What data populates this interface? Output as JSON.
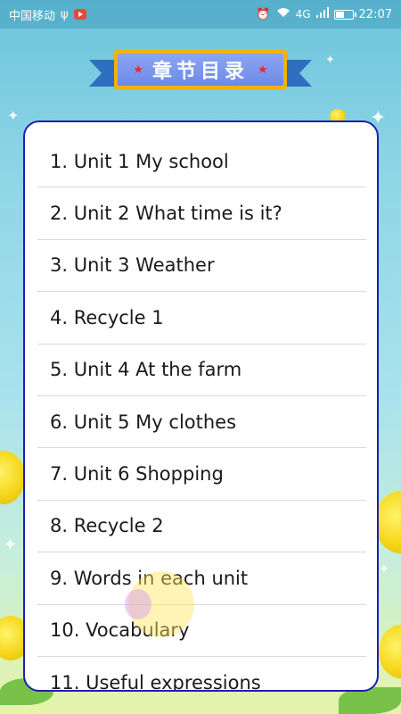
{
  "status_bar": {
    "carrier": "中国移动",
    "usb_icon": "usb-icon",
    "network_label": "4G",
    "time": "22:07"
  },
  "header": {
    "title": "章节目录"
  },
  "chapters": [
    "1. Unit 1 My school",
    "2. Unit 2 What time is it?",
    "3. Unit 3 Weather",
    "4. Recycle 1",
    "5. Unit 4 At the farm",
    "6. Unit 5 My clothes",
    "7. Unit 6 Shopping",
    "8. Recycle 2",
    "9. Words in each unit",
    "10. Vocabulary",
    "11. Useful expressions"
  ],
  "colors": {
    "card_border": "#1d1fb0",
    "banner_fill": "#7b96ee",
    "banner_frame": "#f2b10c",
    "star": "#e8292b"
  }
}
